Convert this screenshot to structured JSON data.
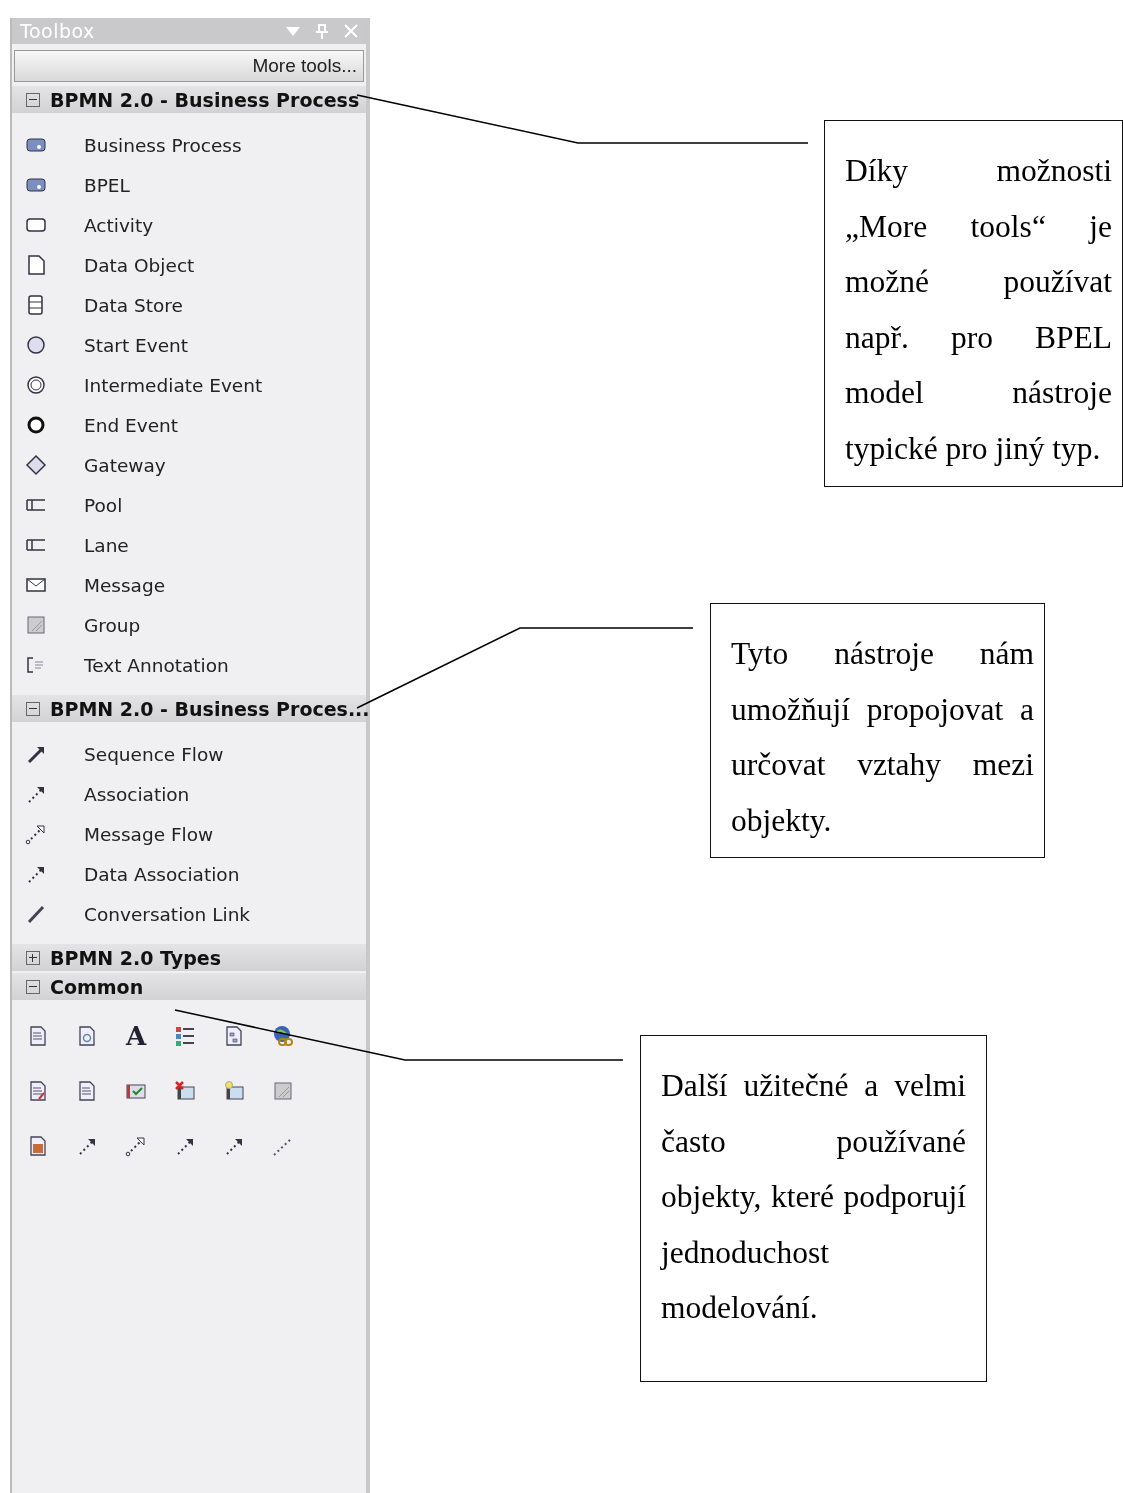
{
  "toolbox": {
    "title": "Toolbox",
    "more_tools": "More tools...",
    "sections": [
      {
        "title": "BPMN 2.0 - Business Process",
        "expanded": true,
        "kind": "list",
        "items": [
          {
            "label": "Business Process",
            "kind": "process"
          },
          {
            "label": "BPEL",
            "kind": "process"
          },
          {
            "label": "Activity",
            "kind": "activity"
          },
          {
            "label": "Data Object",
            "kind": "data-object"
          },
          {
            "label": "Data Store",
            "kind": "data-store"
          },
          {
            "label": "Start Event",
            "kind": "start-event"
          },
          {
            "label": "Intermediate Event",
            "kind": "intermediate-event"
          },
          {
            "label": "End Event",
            "kind": "end-event"
          },
          {
            "label": "Gateway",
            "kind": "gateway"
          },
          {
            "label": "Pool",
            "kind": "pool"
          },
          {
            "label": "Lane",
            "kind": "pool"
          },
          {
            "label": "Message",
            "kind": "message"
          },
          {
            "label": "Group",
            "kind": "group"
          },
          {
            "label": "Text Annotation",
            "kind": "annotation"
          }
        ]
      },
      {
        "title": "BPMN 2.0 - Business Proces...",
        "expanded": true,
        "kind": "list",
        "items": [
          {
            "label": "Sequence Flow",
            "kind": "sequence-flow"
          },
          {
            "label": "Association",
            "kind": "association"
          },
          {
            "label": "Message Flow",
            "kind": "message-flow"
          },
          {
            "label": "Data Association",
            "kind": "association"
          },
          {
            "label": "Conversation Link",
            "kind": "conversation-link"
          }
        ]
      },
      {
        "title": "BPMN 2.0 Types",
        "expanded": false
      },
      {
        "title": "Common",
        "expanded": true,
        "kind": "grid",
        "items": [
          {
            "kind": "note"
          },
          {
            "kind": "doc-refresh"
          },
          {
            "kind": "text",
            "glyph": "A"
          },
          {
            "kind": "list"
          },
          {
            "kind": "diagram-doc"
          },
          {
            "kind": "globe-link"
          },
          {
            "kind": "doc-edit"
          },
          {
            "kind": "doc"
          },
          {
            "kind": "checkbox"
          },
          {
            "kind": "x-folder"
          },
          {
            "kind": "star-folder"
          },
          {
            "kind": "group"
          },
          {
            "kind": "image-doc"
          },
          {
            "kind": "association"
          },
          {
            "kind": "message-flow"
          },
          {
            "kind": "association"
          },
          {
            "kind": "association"
          },
          {
            "kind": "dashed-line"
          }
        ]
      }
    ]
  },
  "callouts": [
    {
      "text": "Díky možnosti „More tools“ je možné používat např. pro BPEL model nástroje typické pro jiný typ."
    },
    {
      "text": "Tyto nástroje nám umožňují propojovat a určovat vztahy mezi objekty."
    },
    {
      "text": "Další užitečné a velmi často používané objekty, které podporují jednoduchost modelování."
    }
  ]
}
